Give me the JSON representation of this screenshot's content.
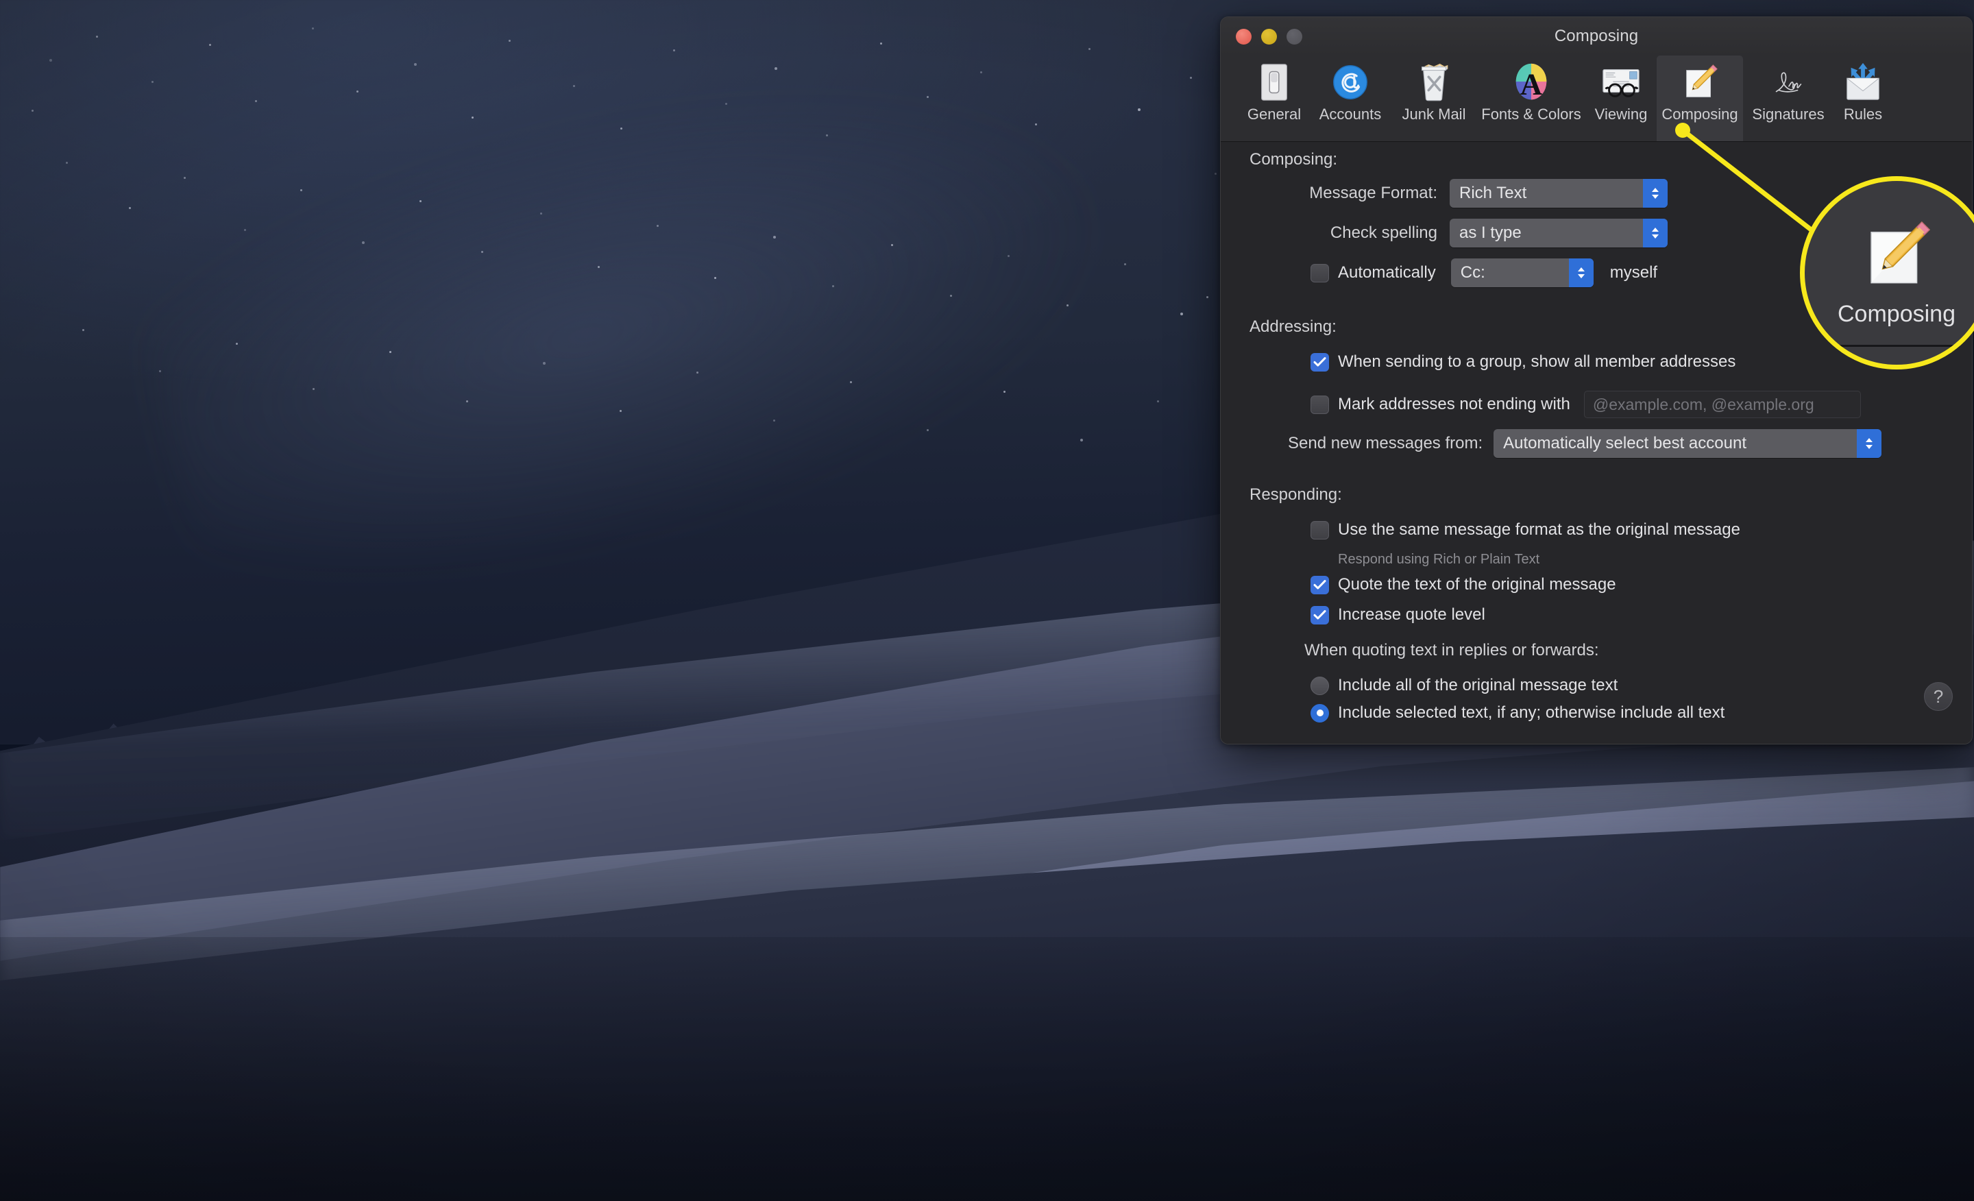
{
  "window": {
    "title": "Composing",
    "traffic_lights": [
      "close",
      "minimize",
      "zoom"
    ]
  },
  "toolbar": {
    "items": [
      {
        "label": "General",
        "icon": "light-switch-icon",
        "selected": false
      },
      {
        "label": "Accounts",
        "icon": "at-sign-icon",
        "selected": false
      },
      {
        "label": "Junk Mail",
        "icon": "trash-can-icon",
        "selected": false
      },
      {
        "label": "Fonts & Colors",
        "icon": "color-wheel-a-icon",
        "selected": false
      },
      {
        "label": "Viewing",
        "icon": "envelope-glasses-icon",
        "selected": false
      },
      {
        "label": "Composing",
        "icon": "pencil-paper-icon",
        "selected": true
      },
      {
        "label": "Signatures",
        "icon": "signature-icon",
        "selected": false
      },
      {
        "label": "Rules",
        "icon": "envelope-arrows-icon",
        "selected": false
      }
    ]
  },
  "composing": {
    "section_label": "Composing:",
    "message_format": {
      "label": "Message Format:",
      "value": "Rich Text"
    },
    "check_spelling": {
      "label": "Check spelling",
      "value": "as I type"
    },
    "auto_cc": {
      "checked": false,
      "label": "Automatically",
      "value": "Cc:",
      "suffix": "myself"
    }
  },
  "addressing": {
    "section_label": "Addressing:",
    "show_group_members": {
      "checked": true,
      "label": "When sending to a group, show all member addresses"
    },
    "mark_addresses": {
      "checked": false,
      "label": "Mark addresses not ending with",
      "placeholder": "@example.com, @example.org"
    },
    "send_from": {
      "label": "Send new messages from:",
      "value": "Automatically select best account"
    }
  },
  "responding": {
    "section_label": "Responding:",
    "same_format": {
      "checked": false,
      "label": "Use the same message format as the original message",
      "note": "Respond using Rich or Plain Text"
    },
    "quote_text": {
      "checked": true,
      "label": "Quote the text of the original message"
    },
    "increase_quote": {
      "checked": true,
      "label": "Increase quote level"
    },
    "quoting_group_label": "When quoting text in replies or forwards:",
    "quoting_options": [
      {
        "label": "Include all of the original message text",
        "selected": false
      },
      {
        "label": "Include selected text, if any; otherwise include all text",
        "selected": true
      }
    ]
  },
  "help": {
    "label": "?"
  },
  "callout": {
    "label": "Composing",
    "icon": "pencil-paper-icon",
    "highlight_color": "#f7e81c"
  },
  "colors": {
    "accent_blue": "#2f6fd8",
    "checkbox_blue": "#3a6fd8",
    "window_bg": "#262629",
    "toolbar_bg": "#2d2d30",
    "titlebar_bg": "#2f2f32",
    "popup_bg": "#5b5b60",
    "text_primary": "#e2e2e5",
    "text_secondary": "#8e8e93",
    "callout_yellow": "#f7e81c"
  }
}
